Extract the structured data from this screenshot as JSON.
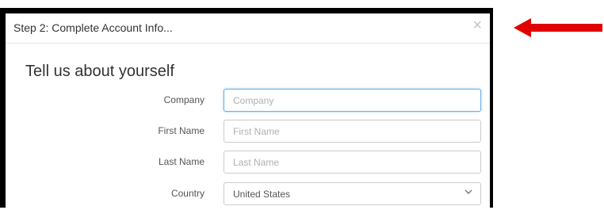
{
  "modal": {
    "title": "Step 2: Complete Account Info...",
    "close_label": "×",
    "heading": "Tell us about yourself"
  },
  "form": {
    "company": {
      "label": "Company",
      "placeholder": "Company"
    },
    "first_name": {
      "label": "First Name",
      "placeholder": "First Name"
    },
    "last_name": {
      "label": "Last Name",
      "placeholder": "Last Name"
    },
    "country": {
      "label": "Country",
      "value": "United States"
    }
  },
  "colors": {
    "arrow": "#e00000",
    "focus_border": "#66afe9"
  },
  "icons": {
    "close": "close-icon",
    "select": "chevron-down-icon",
    "pointer": "red-arrow-icon"
  }
}
